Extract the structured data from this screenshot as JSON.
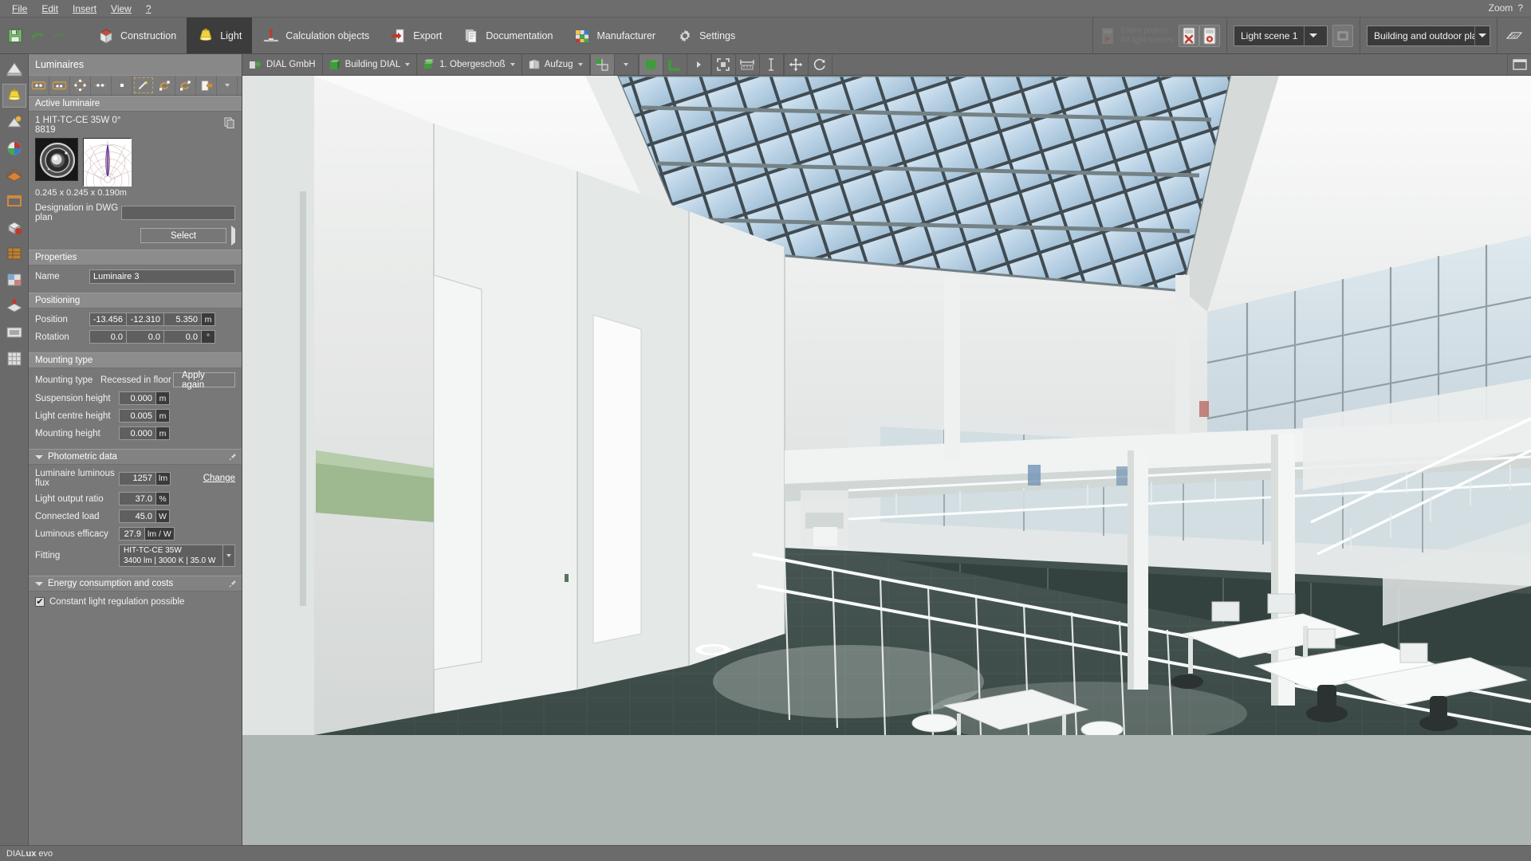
{
  "window": {
    "zoom_label": "Zoom",
    "zoom_help": "?",
    "status_brand_pre": "DIAL",
    "status_brand_mid": "ux",
    "status_brand_post": " evo"
  },
  "menu": {
    "items": [
      {
        "label": "File",
        "accel": "F"
      },
      {
        "label": "Edit",
        "accel": "E"
      },
      {
        "label": "Insert",
        "accel": "I"
      },
      {
        "label": "View",
        "accel": "V"
      },
      {
        "label": "?",
        "accel": "?"
      }
    ]
  },
  "ribbon": {
    "quick": [
      {
        "name": "save-icon",
        "label": "Save"
      },
      {
        "name": "undo-icon",
        "label": "Undo"
      },
      {
        "name": "redo-icon",
        "label": "Redo"
      }
    ],
    "tabs": [
      {
        "label": "Construction",
        "icon": "construction-icon",
        "active": false
      },
      {
        "label": "Light",
        "icon": "light-bulb-icon",
        "active": true
      },
      {
        "label": "Calculation objects",
        "icon": "calculation-objects-icon",
        "active": false
      },
      {
        "label": "Export",
        "icon": "export-icon",
        "active": false
      },
      {
        "label": "Documentation",
        "icon": "documentation-icon",
        "active": false
      },
      {
        "label": "Manufacturer",
        "icon": "manufacturer-icon",
        "active": false
      },
      {
        "label": "Settings",
        "icon": "settings-gear-icon",
        "active": false
      }
    ],
    "calc_group": {
      "start_line1": "Entire project",
      "start_line2": "All light scenes",
      "cancel_tooltip": "Cancel calculation",
      "settings_tooltip": "Calculation settings"
    },
    "light_scene": {
      "value": "Light scene 1",
      "options": [
        "Light scene 1"
      ]
    },
    "view_selector": {
      "value": "Building and outdoor pla...",
      "options": [
        "Building and outdoor pla..."
      ]
    }
  },
  "rail": {
    "items": [
      {
        "name": "rail-item-plan",
        "label": "Plan"
      },
      {
        "name": "rail-item-luminaires",
        "label": "Luminaires",
        "selected": true
      },
      {
        "name": "rail-item-daylight",
        "label": "Daylight"
      },
      {
        "name": "rail-item-colours",
        "label": "Colours"
      },
      {
        "name": "rail-item-furniture",
        "label": "Furniture"
      },
      {
        "name": "rail-item-room",
        "label": "Room"
      },
      {
        "name": "rail-item-objects",
        "label": "Objects"
      },
      {
        "name": "rail-item-materials",
        "label": "Materials"
      },
      {
        "name": "rail-item-calc-surface",
        "label": "Calculation surface"
      },
      {
        "name": "rail-item-workplane",
        "label": "Work plane"
      },
      {
        "name": "rail-item-viewport",
        "label": "Viewport"
      },
      {
        "name": "rail-item-grid",
        "label": "Grid"
      }
    ]
  },
  "panel": {
    "title": "Luminaires",
    "toolbar": [
      {
        "name": "place-single-luminaire-icon",
        "label": "Single luminaire"
      },
      {
        "name": "place-luminaire-pair-icon",
        "label": "Luminaire pair"
      },
      {
        "name": "place-luminaire-circle-icon",
        "label": "Luminaire circle"
      },
      {
        "name": "place-luminaire-line-icon",
        "label": "Luminaire line"
      },
      {
        "name": "place-luminaire-point-icon",
        "label": "Luminaire point"
      },
      {
        "name": "luminaire-wizard-icon",
        "label": "Luminaire arrangement wizard"
      },
      {
        "name": "exchange-luminaire-icon",
        "label": "Exchange luminaire"
      },
      {
        "name": "exchange-all-luminaires-icon",
        "label": "Exchange all luminaires"
      },
      {
        "name": "import-luminaire-icon",
        "label": "Import luminaire"
      }
    ],
    "active_luminaire": {
      "section_title": "Active luminaire",
      "name": "1 HIT-TC-CE 35W 0°",
      "article_no": "8819",
      "dimensions": "0.245 x 0.245 x 0.190m",
      "copy_icon": "copy-icon",
      "dwg_label": "Designation in DWG plan",
      "dwg_value": "",
      "select_button": "Select"
    },
    "properties": {
      "section_title": "Properties",
      "name_label": "Name",
      "name_value": "Luminaire 3"
    },
    "positioning": {
      "section_title": "Positioning",
      "position_label": "Position",
      "position_x": "-13.456",
      "position_y": "-12.310",
      "position_z": "5.350",
      "position_unit": "m",
      "rotation_label": "Rotation",
      "rotation_x": "0.0",
      "rotation_y": "0.0",
      "rotation_z": "0.0",
      "rotation_unit": "°"
    },
    "mounting": {
      "section_title": "Mounting type",
      "type_label": "Mounting type",
      "type_value": "Recessed in floor",
      "apply_again_button": "Apply again",
      "suspension_label": "Suspension height",
      "suspension_value": "0.000",
      "suspension_unit": "m",
      "light_centre_label": "Light centre height",
      "light_centre_value": "0.005",
      "light_centre_unit": "m",
      "mounting_height_label": "Mounting height",
      "mounting_height_value": "0.000",
      "mounting_height_unit": "m"
    },
    "photometric": {
      "section_title": "Photometric data",
      "flux_label": "Luminaire luminous flux",
      "flux_value": "1257",
      "flux_unit": "lm",
      "change_link": "Change",
      "lor_label": "Light output ratio",
      "lor_value": "37.0",
      "lor_unit": "%",
      "load_label": "Connected load",
      "load_value": "45.0",
      "load_unit": "W",
      "efficacy_label": "Luminous efficacy",
      "efficacy_value": "27.9",
      "efficacy_unit": "lm / W",
      "fitting_label": "Fitting",
      "fitting_line1": "HIT-TC-CE  35W",
      "fitting_line2": "3400 lm  |  3000 K  |  35.0 W"
    },
    "energy": {
      "section_title": "Energy consumption and costs",
      "constant_light_label": "Constant light regulation possible",
      "constant_light_checked": true
    }
  },
  "viewport": {
    "breadcrumbs": [
      {
        "label": "DIAL GmbH",
        "icon": "company-icon",
        "has_arrow": false
      },
      {
        "label": "Building DIAL",
        "icon": "building-icon",
        "has_arrow": true
      },
      {
        "label": "1. Obergeschoß",
        "icon": "storey-icon",
        "has_arrow": true
      },
      {
        "label": "Aufzug",
        "icon": "room-icon",
        "has_arrow": true
      }
    ],
    "tools": [
      {
        "name": "view-mode-icon",
        "label": "View mode",
        "has_arrow": true
      },
      {
        "name": "render-solid-icon",
        "label": "Solid rendering",
        "selected": true
      },
      {
        "name": "render-wire-icon",
        "label": "Wireframe rendering",
        "has_arrow": true
      },
      {
        "name": "fit-to-screen-icon",
        "label": "Fit to screen"
      },
      {
        "name": "measure-horizontal-icon",
        "label": "Measure horizontally"
      },
      {
        "name": "measure-vertical-icon",
        "label": "Measure vertically"
      },
      {
        "name": "move-icon",
        "label": "Move"
      },
      {
        "name": "rotate-icon",
        "label": "Rotate"
      }
    ],
    "right_tools": [
      {
        "name": "fullscreen-icon",
        "label": "Full screen"
      }
    ]
  }
}
